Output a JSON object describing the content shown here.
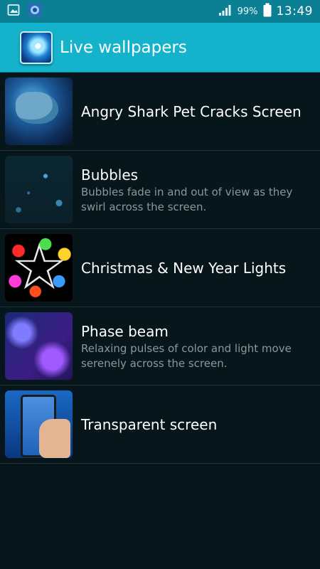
{
  "status_bar": {
    "left_icons": [
      "image-icon",
      "wallpaper-notification-icon"
    ],
    "battery_percent": "99%",
    "time": "13:49"
  },
  "action_bar": {
    "title": "Live wallpapers",
    "icon": "live-wallpaper-app-icon",
    "color": "#15b3cb"
  },
  "items": [
    {
      "title": "Angry Shark Pet Cracks Screen",
      "description": ""
    },
    {
      "title": "Bubbles",
      "description": "Bubbles fade in and out of view as they swirl across the screen."
    },
    {
      "title": "Christmas & New Year Lights",
      "description": ""
    },
    {
      "title": "Phase beam",
      "description": "Relaxing pulses of color and light move serenely across the screen."
    },
    {
      "title": "Transparent screen",
      "description": ""
    }
  ]
}
